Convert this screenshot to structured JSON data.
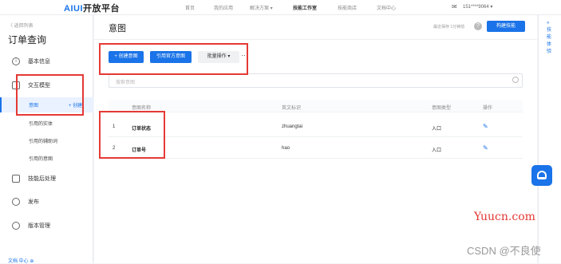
{
  "topbar": {
    "logo_a": "AIUI",
    "logo_b": "开放平台",
    "nav": [
      "首页",
      "我的应用",
      "解决方案 ▾",
      "技能工作室",
      "技能商店",
      "文档中心"
    ],
    "user": "151****9064 ▾"
  },
  "sidebar": {
    "back": "〈 返回列表",
    "title": "订单查询",
    "items": [
      "基本信息",
      "交互模型",
      "技能后处理",
      "发布",
      "版本管理"
    ],
    "subitems": [
      "意图",
      "引用的实体",
      "引用的辅助词",
      "引用的意图"
    ],
    "create": "+ 创建",
    "doc": "文档 中心 ⊕"
  },
  "main": {
    "title": "意图",
    "saved": "最近保存 1分钟前",
    "help": "?",
    "build": "构建技能",
    "create_btn": "+ 创建意图",
    "ref_btn": "引用官方意图",
    "batch_btn": "批量操作 ▾",
    "more": "···",
    "search_placeholder": "搜索意图"
  },
  "table": {
    "headers": [
      "意图名称",
      "英文标识",
      "意图类型",
      "操作"
    ],
    "rows": [
      {
        "idx": "1",
        "name": "订单状态",
        "en": "zhuangtai",
        "type": "入口"
      },
      {
        "idx": "2",
        "name": "订单号",
        "en": "hao",
        "type": "入口"
      }
    ]
  },
  "rightpanel": {
    "text": "« 技能体验"
  },
  "watermark": {
    "site": "Yuucn.com",
    "csdn": "CSDN @不良使"
  }
}
